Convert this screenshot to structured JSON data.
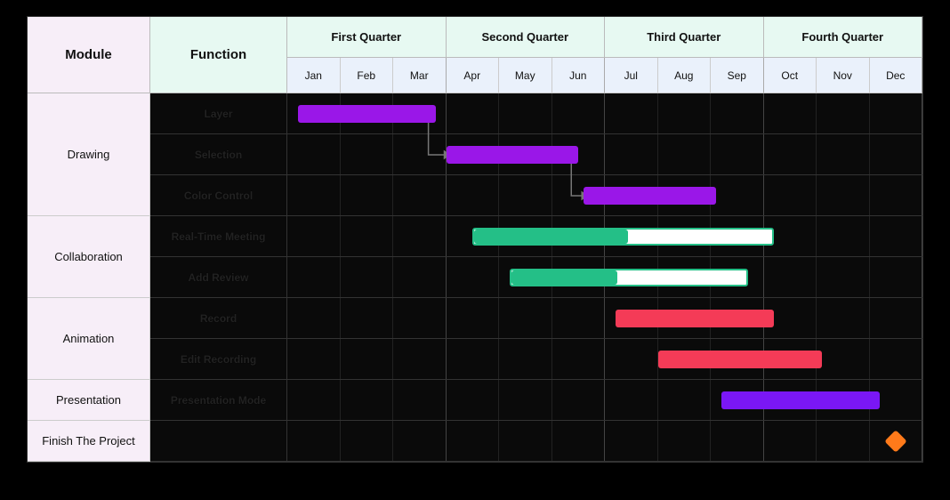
{
  "header": {
    "module_label": "Module",
    "function_label": "Function",
    "quarters": [
      "First Quarter",
      "Second Quarter",
      "Third Quarter",
      "Fourth Quarter"
    ],
    "months": [
      "Jan",
      "Feb",
      "Mar",
      "Apr",
      "May",
      "Jun",
      "Jul",
      "Aug",
      "Sep",
      "Oct",
      "Nov",
      "Dec"
    ]
  },
  "modules": [
    {
      "name": "Drawing",
      "rows": 3
    },
    {
      "name": "Collaboration",
      "rows": 2
    },
    {
      "name": "Animation",
      "rows": 2
    },
    {
      "name": "Presentation",
      "rows": 1
    },
    {
      "name": "Finish The Project",
      "rows": 1
    }
  ],
  "functions": [
    "Layer",
    "Selection",
    "Color Control",
    "Real-Time Meeting",
    "Add Review",
    "Record",
    "Edit Recording",
    "Presentation Mode",
    ""
  ],
  "colors": {
    "purple": "#9a17e8",
    "green": "#24bf87",
    "red": "#f43b57",
    "violet": "#7a17f5",
    "orange": "#ff7a1a"
  },
  "chart_data": {
    "type": "gantt",
    "x_unit": "month",
    "x_categories": [
      "Jan",
      "Feb",
      "Mar",
      "Apr",
      "May",
      "Jun",
      "Jul",
      "Aug",
      "Sep",
      "Oct",
      "Nov",
      "Dec"
    ],
    "xlim": [
      0,
      12
    ],
    "tasks": [
      {
        "id": "layer",
        "module": "Drawing",
        "function": "Layer",
        "row": 0,
        "start": 0.2,
        "end": 2.8,
        "color": "purple"
      },
      {
        "id": "selection",
        "module": "Drawing",
        "function": "Selection",
        "row": 1,
        "start": 3.0,
        "end": 5.5,
        "color": "purple"
      },
      {
        "id": "color-control",
        "module": "Drawing",
        "function": "Color Control",
        "row": 2,
        "start": 5.6,
        "end": 8.1,
        "color": "purple"
      },
      {
        "id": "rtm",
        "module": "Collaboration",
        "function": "Real-Time Meeting",
        "row": 3,
        "start": 3.5,
        "end": 9.2,
        "progress_end": 6.4,
        "color": "green"
      },
      {
        "id": "review",
        "module": "Collaboration",
        "function": "Add Review",
        "row": 4,
        "start": 4.2,
        "end": 8.7,
        "progress_end": 6.2,
        "color": "green"
      },
      {
        "id": "record",
        "module": "Animation",
        "function": "Record",
        "row": 5,
        "start": 6.2,
        "end": 9.2,
        "color": "red"
      },
      {
        "id": "edit-rec",
        "module": "Animation",
        "function": "Edit Recording",
        "row": 6,
        "start": 7.0,
        "end": 10.1,
        "color": "red"
      },
      {
        "id": "pres",
        "module": "Presentation",
        "function": "Presentation Mode",
        "row": 7,
        "start": 8.2,
        "end": 11.2,
        "color": "violet"
      }
    ],
    "milestones": [
      {
        "id": "finish",
        "module": "Finish The Project",
        "row": 8,
        "at": 11.5,
        "color": "orange"
      }
    ],
    "dependencies": [
      {
        "from": "layer",
        "to": "selection"
      },
      {
        "from": "selection",
        "to": "color-control"
      }
    ]
  }
}
